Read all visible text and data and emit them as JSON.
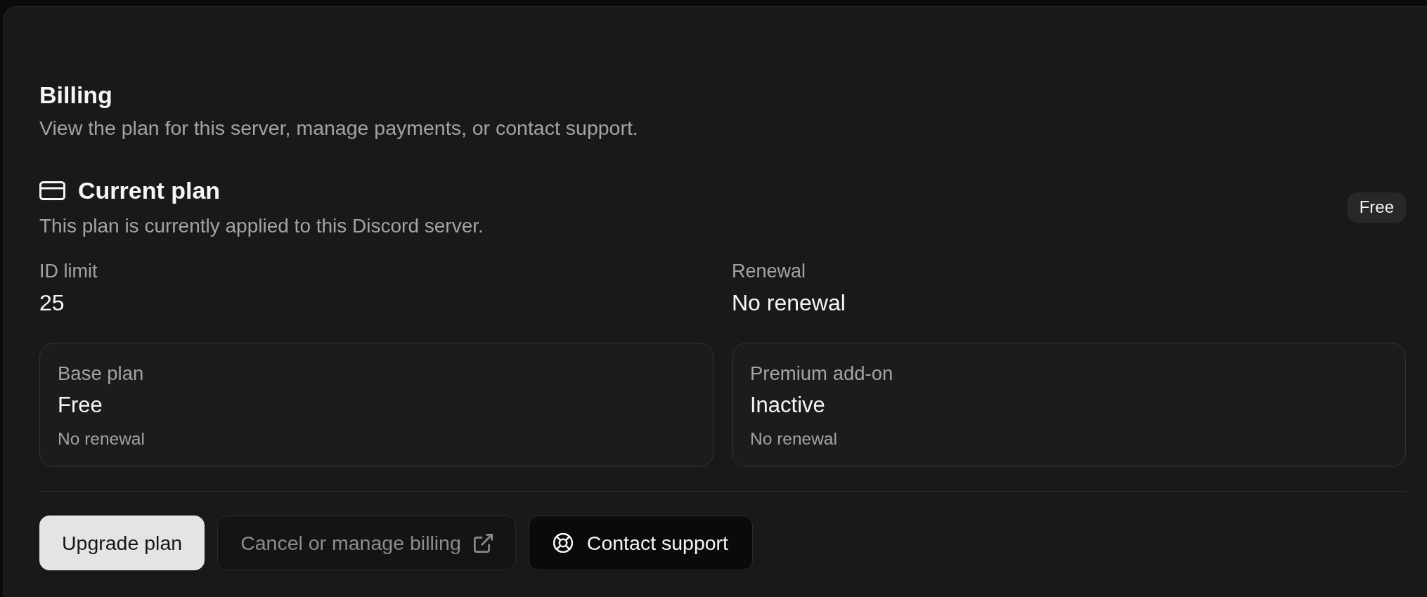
{
  "header": {
    "title": "Billing",
    "subtitle": "View the plan for this server, manage payments, or contact support."
  },
  "current_plan": {
    "title": "Current plan",
    "description": "This plan is currently applied to this Discord server.",
    "badge": "Free",
    "fields": [
      {
        "label": "ID limit",
        "value": "25"
      },
      {
        "label": "Renewal",
        "value": "No renewal"
      }
    ],
    "cards": [
      {
        "label": "Base plan",
        "value": "Free",
        "note": "No renewal"
      },
      {
        "label": "Premium add-on",
        "value": "Inactive",
        "note": "No renewal"
      }
    ]
  },
  "actions": [
    {
      "label": "Upgrade plan",
      "kind": "primary",
      "disabled": false
    },
    {
      "label": "Cancel or manage billing",
      "kind": "external",
      "disabled": true
    },
    {
      "label": "Contact support",
      "kind": "support",
      "disabled": false
    }
  ]
}
